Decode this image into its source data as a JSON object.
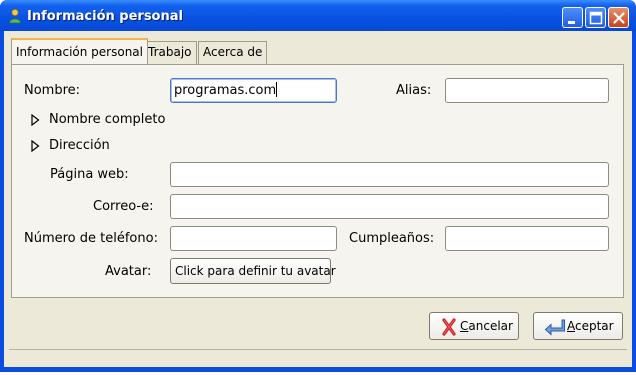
{
  "window": {
    "title": "Información personal",
    "colors": {
      "titlebar": "#0a53e4",
      "client": "#ece9d8",
      "tab_highlight": "#f3b44a"
    },
    "controls": {
      "minimize_icon": "minimize-icon",
      "maximize_icon": "maximize-icon",
      "close_icon": "close-icon"
    }
  },
  "tabs": [
    {
      "label": "Información personal",
      "active": true
    },
    {
      "label": "Trabajo",
      "active": false
    },
    {
      "label": "Acerca de",
      "active": false
    }
  ],
  "form": {
    "nombre_label": "Nombre:",
    "nombre_value": "programas.com",
    "alias_label": "Alias:",
    "alias_value": "",
    "nombre_completo_label": "Nombre completo",
    "direccion_label": "Dirección",
    "pagina_web_label": "Página web:",
    "pagina_web_value": "",
    "correo_label": "Correo-e:",
    "correo_value": "",
    "telefono_label": "Número de teléfono:",
    "telefono_value": "",
    "cumpleanos_label": "Cumpleaños:",
    "cumpleanos_value": "",
    "avatar_label": "Avatar:",
    "avatar_button": "Click para definir tu avatar"
  },
  "buttons": {
    "cancel": {
      "mnemonic": "C",
      "rest": "ancelar",
      "icon": "red-x-icon"
    },
    "accept": {
      "mnemonic": "A",
      "rest": "ceptar",
      "icon": "enter-arrow-icon"
    }
  }
}
